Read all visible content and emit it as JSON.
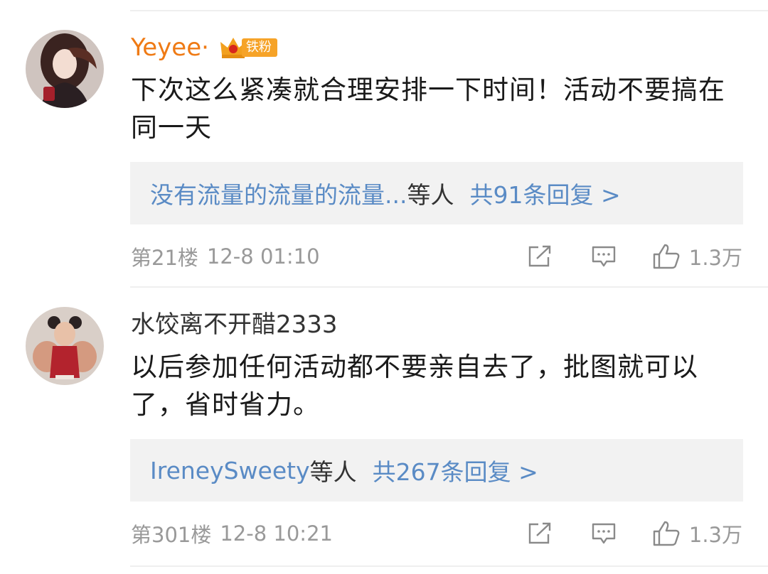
{
  "comments": [
    {
      "username": "Yeyee·",
      "badge_label": "铁粉",
      "text": "下次这么紧凑就合理安排一下时间！活动不要搞在同一天",
      "reply_names": "没有流量的流量的流量...",
      "reply_suffix": "等人",
      "reply_count": "共91条回复 >",
      "floor": "第21楼",
      "time": "12-8 01:10",
      "likes": "1.3万"
    },
    {
      "username": "水饺离不开醋2333",
      "text": "以后参加任何活动都不要亲自去了，批图就可以了，省时省力。",
      "reply_names": "IreneySweety",
      "reply_suffix": "等人",
      "reply_count": "共267条回复 >",
      "floor": "第301楼",
      "time": "12-8 10:21",
      "likes": "1.3万"
    }
  ],
  "icons": {
    "share": "share-icon",
    "comment": "comment-icon",
    "like": "thumbs-up-icon",
    "crown": "crown-icon"
  },
  "colors": {
    "vip_name": "#ef7a14",
    "link_blue": "#5a8bc5",
    "meta_gray": "#999999",
    "reply_bg": "#f2f2f2"
  }
}
